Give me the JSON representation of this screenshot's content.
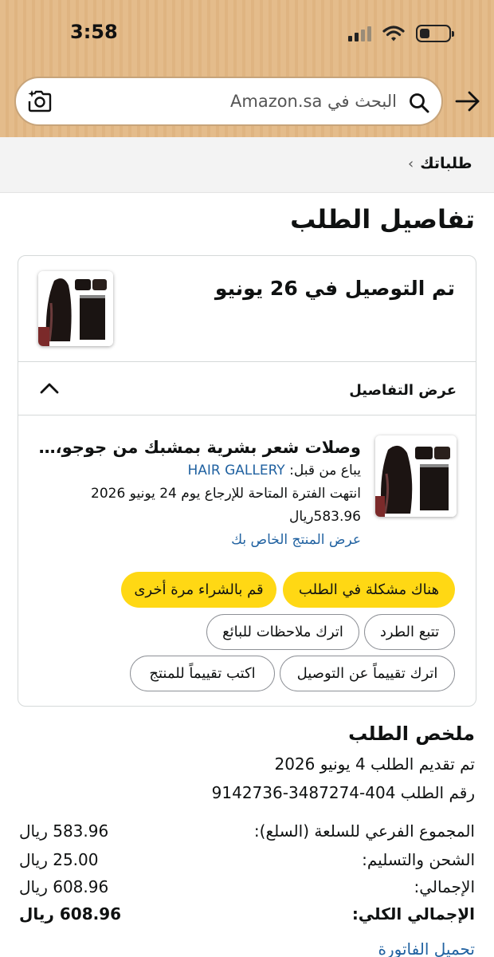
{
  "status_bar": {
    "time": "3:58"
  },
  "search": {
    "placeholder": "البحث في Amazon.sa"
  },
  "breadcrumb": {
    "label": "طلباتك"
  },
  "page": {
    "title": "تفاصيل الطلب"
  },
  "delivery": {
    "status": "تم التوصيل في 26 يونيو"
  },
  "details_toggle": {
    "label": "عرض التفاصيل"
  },
  "product": {
    "title": "وصلات شعر بشرية بمشبك من جوجو، و...",
    "seller_prefix": "يباع من قبل: ",
    "seller_name": "HAIR GALLERY",
    "return_note": "انتهت الفترة المتاحة للإرجاع يوم 24 يونيو 2026",
    "price": "583.96ريال",
    "view_product_link": "عرض المنتج الخاص بك"
  },
  "actions": {
    "problem": "هناك مشكلة في الطلب",
    "buy_again": "قم بالشراء مرة أخرى",
    "track": "تتبع الطرد",
    "seller_feedback": "اترك ملاحظات للبائع",
    "delivery_review": "اترك تقييماً عن التوصيل",
    "product_review": "اكتب تقييماً للمنتج"
  },
  "summary": {
    "title": "ملخص الطلب",
    "placed": "تم تقديم الطلب 4 يونيو 2026",
    "order_number": "رقم الطلب 404-3487274-9142736",
    "rows": [
      {
        "label": "المجموع الفرعي للسلعة (السلع):",
        "value": "583.96 ريال"
      },
      {
        "label": "الشحن والتسليم:",
        "value": "25.00 ريال"
      },
      {
        "label": "الإجمالي:",
        "value": "608.96 ريال"
      },
      {
        "label": "الإجمالي الكلي:",
        "value": "608.96 ريال"
      }
    ],
    "invoice_link": "تحميل الفاتورة"
  },
  "colors": {
    "header_bg": "#e4bc8b",
    "button_yellow": "#ffd814",
    "link": "#2162a1"
  },
  "icons": [
    "camera-search-icon",
    "search-icon",
    "back-arrow-icon",
    "chevron-right-icon",
    "chevron-up-icon",
    "signal-icon",
    "wifi-icon",
    "battery-icon"
  ]
}
